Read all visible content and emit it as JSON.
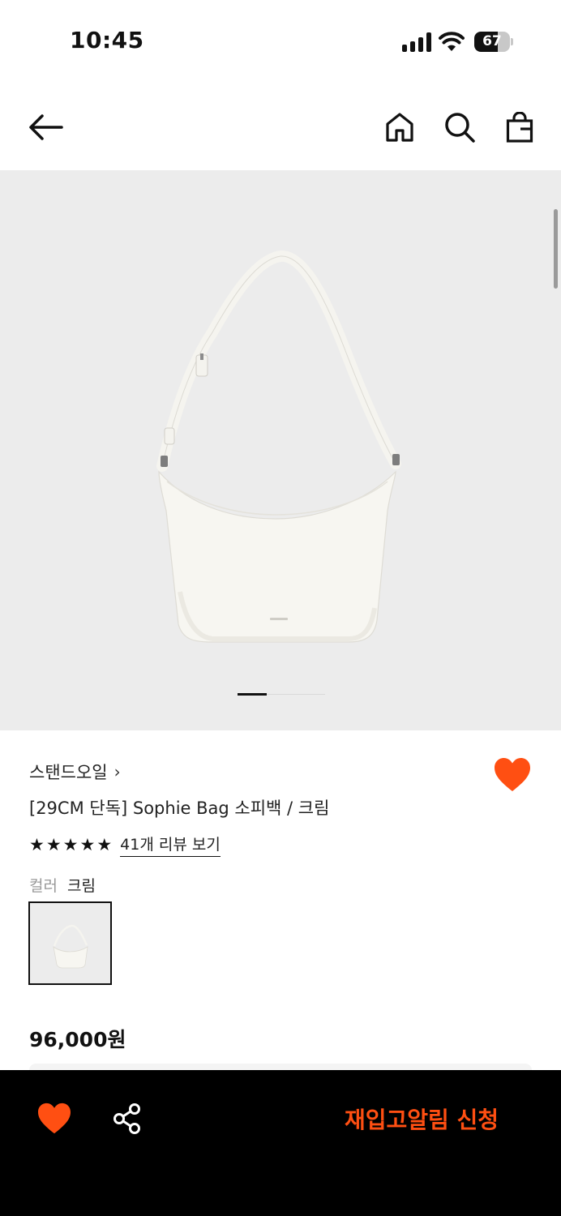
{
  "status_bar": {
    "time": "10:45",
    "battery": "67",
    "battery_level_percent": 67
  },
  "nav": {
    "back_icon": "arrow-left-icon",
    "home_icon": "home-icon",
    "search_icon": "search-icon",
    "cart_icon": "shopping-bag-icon"
  },
  "gallery": {
    "current_index": 1,
    "total": 3
  },
  "product": {
    "brand": "스탠드오일",
    "brand_chevron": "›",
    "title": "[29CM 단독] Sophie Bag 소피백 / 크림",
    "rating_stars": 5,
    "review_link": "41개 리뷰 보기",
    "color_label": "컬러",
    "color_value": "크림",
    "price": "96,000원",
    "wishlisted": true
  },
  "bottom_bar": {
    "restock_button": "재입고알림 신청",
    "share_icon": "share-icon",
    "heart_icon": "heart-icon"
  },
  "colors": {
    "accent": "#ff4f12",
    "gallery_bg": "#ececec",
    "bottom_bar_bg": "#000000"
  }
}
